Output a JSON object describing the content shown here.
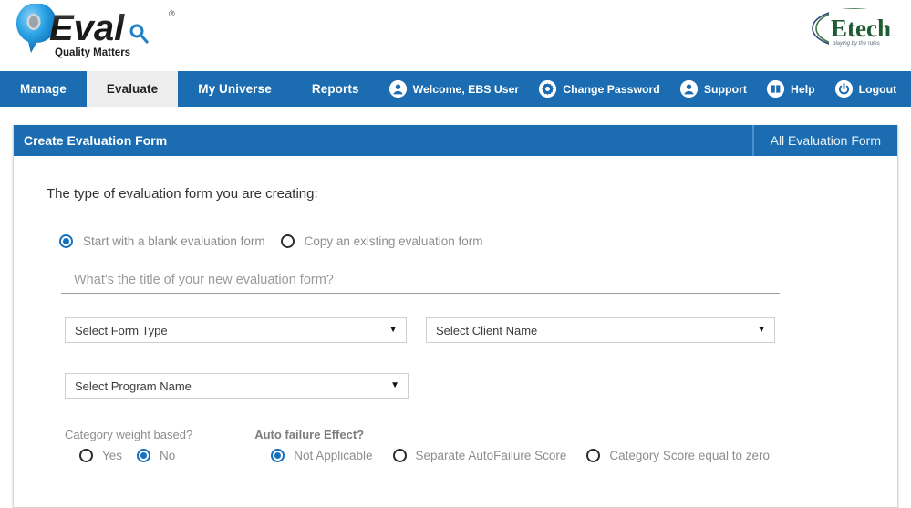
{
  "header": {
    "brand_logo": {
      "name": "qeval-logo",
      "text": "QEval",
      "tagline": "Quality Matters",
      "trademark": "®"
    },
    "partner_logo": {
      "name": "etech-logo",
      "text": "Etech",
      "tagline": "playing by the rules"
    }
  },
  "nav": {
    "primary": [
      {
        "label": "Manage",
        "active": false
      },
      {
        "label": "Evaluate",
        "active": true
      },
      {
        "label": "My Universe",
        "active": false
      },
      {
        "label": "Reports",
        "active": false
      }
    ],
    "utilities": [
      {
        "label": "Welcome, EBS User",
        "icon": "user-icon"
      },
      {
        "label": "Change Password",
        "icon": "gear-icon"
      },
      {
        "label": "Support",
        "icon": "user-icon"
      },
      {
        "label": "Help",
        "icon": "book-icon"
      },
      {
        "label": "Logout",
        "icon": "power-icon"
      }
    ]
  },
  "page": {
    "title": "Create Evaluation"
  },
  "panel": {
    "title": "Create Evaluation Form",
    "tab_label": "All Evaluation Form"
  },
  "form": {
    "heading": "The type of evaluation form you are creating:",
    "type_options": [
      {
        "label": "Start with a blank evaluation form",
        "selected": true
      },
      {
        "label": "Copy an existing evaluation form",
        "selected": false
      }
    ],
    "title_input": {
      "value": "",
      "placeholder": "What's the title of your new evaluation form?"
    },
    "selects": [
      {
        "name": "form-type",
        "value": "Select Form Type",
        "caret": "▼"
      },
      {
        "name": "client-name",
        "value": "Select Client Name",
        "caret": "▼"
      },
      {
        "name": "program-name",
        "value": "Select Program Name",
        "caret": "▼"
      }
    ],
    "category_weight": {
      "label": "Category weight based?",
      "options": [
        {
          "label": "Yes",
          "selected": false
        },
        {
          "label": "No",
          "selected": true
        }
      ]
    },
    "auto_failure": {
      "label": "Auto failure Effect?",
      "options": [
        {
          "label": "Not Applicable",
          "selected": true
        },
        {
          "label": "Separate AutoFailure Score",
          "selected": false
        },
        {
          "label": "Category Score equal to zero",
          "selected": false
        }
      ]
    }
  },
  "colors": {
    "nav_blue": "#1b6cb0",
    "accent_blue": "#1570bf",
    "active_tab_bg": "#ededed",
    "label_gray": "#8d8d8d"
  }
}
